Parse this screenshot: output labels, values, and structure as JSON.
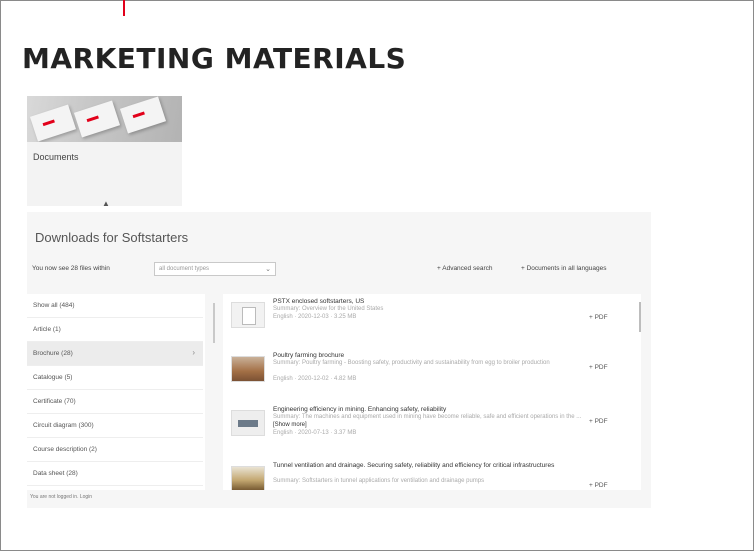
{
  "page": {
    "title": "MARKETING MATERIALS",
    "accent_color": "#e2001a"
  },
  "card": {
    "label": "Documents",
    "image_icon": "brochure-stack-image",
    "caret_icon": "caret-up-icon"
  },
  "panel": {
    "title": "Downloads for Softstarters",
    "search_prefix": "You now see 28 files within",
    "select_value": "all document types",
    "select_icon": "chevron-down-icon",
    "advanced_search": "+ Advanced search",
    "all_languages": "+ Documents in all languages",
    "login_note": "You are not logged in. Login"
  },
  "categories": [
    {
      "label": "Show all (484)"
    },
    {
      "label": "Article (1)"
    },
    {
      "label": "Brochure (28)",
      "active": true
    },
    {
      "label": "Catalogue (5)"
    },
    {
      "label": "Certificate (70)"
    },
    {
      "label": "Circuit diagram (300)"
    },
    {
      "label": "Course description (2)"
    },
    {
      "label": "Data sheet (28)"
    }
  ],
  "documents": [
    {
      "title": "PSTX enclosed softstarters, US",
      "summary": "Summary: Overview for the United States",
      "meta": "English · 2020-12-03 · 3.25 MB",
      "download": "+ PDF",
      "thumb": "document-page-thumbnail"
    },
    {
      "title": "Poultry farming brochure",
      "summary": "Summary: Poultry farming - Boosting safety, productivity and sustainability from egg to broiler production",
      "meta": "English · 2020-12-02 · 4.82 MB",
      "download": "+ PDF",
      "thumb": "poultry-photo-thumbnail"
    },
    {
      "title": "Engineering efficiency in mining. Enhancing safety, reliability",
      "summary": "Summary: The machines and equipment used in mining have become reliable, safe and efficient operations in the ...",
      "show_more": "[Show more]",
      "meta": "English · 2020-07-13 · 3.37 MB",
      "download": "+ PDF",
      "thumb": "mining-equipment-thumbnail"
    },
    {
      "title": "Tunnel ventilation and drainage. Securing safety, reliability and efficiency for critical infrastructures",
      "summary": "Summary: Softstarters in tunnel applications for ventilation and drainage pumps",
      "meta": "",
      "download": "+ PDF",
      "thumb": "tunnel-photo-thumbnail"
    }
  ]
}
